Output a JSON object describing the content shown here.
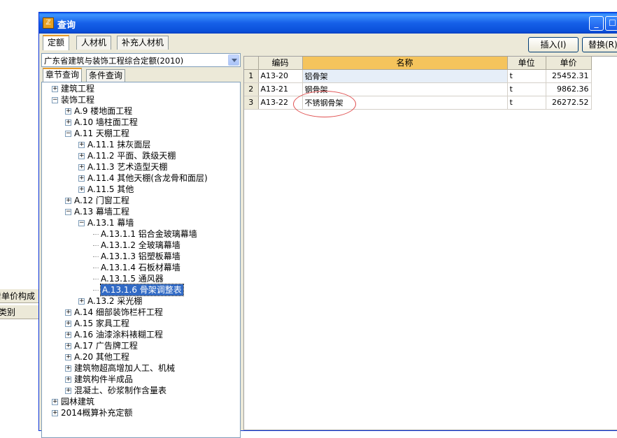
{
  "window": {
    "title": "查询"
  },
  "background_fragments": [
    "看单价构成",
    "类别"
  ],
  "tabs": [
    {
      "label": "定额",
      "active": true
    },
    {
      "label": "人材机",
      "active": false
    },
    {
      "label": "补充人材机",
      "active": false
    }
  ],
  "toolbar": {
    "insert_label": "插入(I)",
    "replace_label": "替换(R)"
  },
  "left": {
    "quota_combo": "广东省建筑与装饰工程综合定额(2010)",
    "subtabs": [
      {
        "label": "章节查询",
        "active": true
      },
      {
        "label": "条件查询",
        "active": false
      }
    ]
  },
  "tree": [
    {
      "label": "建筑工程",
      "level": 0,
      "state": "collapsed"
    },
    {
      "label": "装饰工程",
      "level": 0,
      "state": "expanded"
    },
    {
      "label": "A.9 楼地面工程",
      "level": 1,
      "state": "collapsed"
    },
    {
      "label": "A.10 墙柱面工程",
      "level": 1,
      "state": "collapsed"
    },
    {
      "label": "A.11 天棚工程",
      "level": 1,
      "state": "expanded"
    },
    {
      "label": "A.11.1 抹灰面层",
      "level": 2,
      "state": "collapsed"
    },
    {
      "label": "A.11.2 平面、跌级天棚",
      "level": 2,
      "state": "collapsed"
    },
    {
      "label": "A.11.3 艺术造型天棚",
      "level": 2,
      "state": "collapsed"
    },
    {
      "label": "A.11.4 其他天棚(含龙骨和面层)",
      "level": 2,
      "state": "collapsed"
    },
    {
      "label": "A.11.5 其他",
      "level": 2,
      "state": "collapsed"
    },
    {
      "label": "A.12 门窗工程",
      "level": 1,
      "state": "collapsed"
    },
    {
      "label": "A.13 幕墙工程",
      "level": 1,
      "state": "expanded"
    },
    {
      "label": "A.13.1 幕墙",
      "level": 2,
      "state": "expanded"
    },
    {
      "label": "A.13.1.1 铝合金玻璃幕墙",
      "level": 3,
      "state": "leaf"
    },
    {
      "label": "A.13.1.2 全玻璃幕墙",
      "level": 3,
      "state": "leaf"
    },
    {
      "label": "A.13.1.3 铝塑板幕墙",
      "level": 3,
      "state": "leaf"
    },
    {
      "label": "A.13.1.4 石板材幕墙",
      "level": 3,
      "state": "leaf"
    },
    {
      "label": "A.13.1.5 通风器",
      "level": 3,
      "state": "leaf"
    },
    {
      "label": "A.13.1.6 骨架调整表",
      "level": 3,
      "state": "leaf",
      "selected": true
    },
    {
      "label": "A.13.2 采光棚",
      "level": 2,
      "state": "collapsed"
    },
    {
      "label": "A.14 细部装饰栏杆工程",
      "level": 1,
      "state": "collapsed"
    },
    {
      "label": "A.15 家具工程",
      "level": 1,
      "state": "collapsed"
    },
    {
      "label": "A.16 油漆涂料裱糊工程",
      "level": 1,
      "state": "collapsed"
    },
    {
      "label": "A.17 广告牌工程",
      "level": 1,
      "state": "collapsed"
    },
    {
      "label": "A.20 其他工程",
      "level": 1,
      "state": "collapsed"
    },
    {
      "label": "建筑物超高增加人工、机械",
      "level": 1,
      "state": "collapsed"
    },
    {
      "label": "建筑构件半成品",
      "level": 1,
      "state": "collapsed"
    },
    {
      "label": "混凝土、砂浆制作含量表",
      "level": 1,
      "state": "collapsed"
    },
    {
      "label": "园林建筑",
      "level": 0,
      "state": "collapsed"
    },
    {
      "label": "2014概算补充定额",
      "level": 0,
      "state": "collapsed"
    }
  ],
  "grid": {
    "columns": [
      "编码",
      "名称",
      "单位",
      "单价"
    ],
    "rows": [
      {
        "no": "1",
        "code": "A13-20",
        "name": "铝骨架",
        "unit": "t",
        "price": "25452.31"
      },
      {
        "no": "2",
        "code": "A13-21",
        "name": "钢骨架",
        "unit": "t",
        "price": "9862.36"
      },
      {
        "no": "3",
        "code": "A13-22",
        "name": "不锈钢骨架",
        "unit": "t",
        "price": "26272.52"
      }
    ]
  },
  "colors": {
    "title_blue": "#1660e8",
    "selection": "#316ac5",
    "header_highlight": "#f5c45c",
    "annotation": "#e05050"
  }
}
